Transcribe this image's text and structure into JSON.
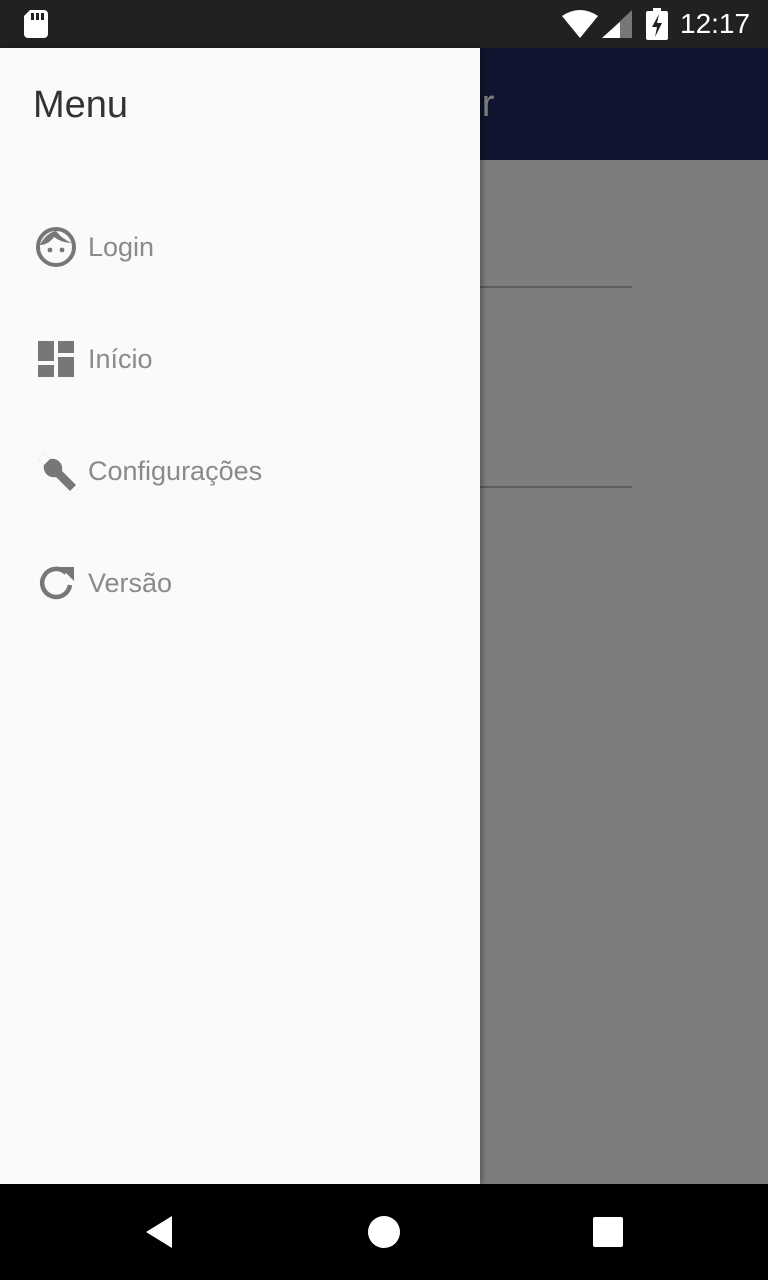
{
  "status_bar": {
    "time": "12:17",
    "icons": [
      "sd-card-icon",
      "wifi-icon",
      "cell-signal-icon",
      "battery-charging-icon"
    ]
  },
  "app": {
    "toolbar_title_visible": "tor",
    "toolbar_color": "#1f2a5c"
  },
  "drawer": {
    "title": "Menu",
    "items": [
      {
        "label": "Login",
        "icon": "face-icon"
      },
      {
        "label": "Início",
        "icon": "dashboard-icon"
      },
      {
        "label": "Configurações",
        "icon": "wrench-icon"
      },
      {
        "label": "Versão",
        "icon": "refresh-icon"
      }
    ]
  },
  "nav_bar": {
    "buttons": [
      "back-icon",
      "home-icon",
      "recents-icon"
    ]
  },
  "colors": {
    "status_bar": "#212121",
    "drawer_background": "#fafafa",
    "item_text": "#8a8a8a",
    "scrim": "rgba(0,0,0,0.5)"
  }
}
